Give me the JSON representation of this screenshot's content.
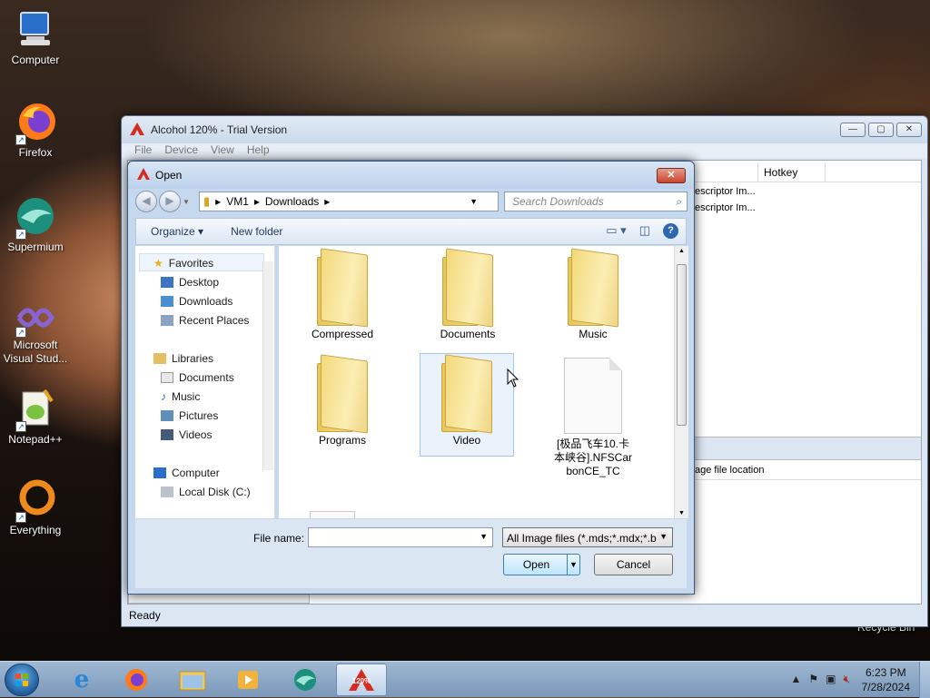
{
  "desktop": {
    "icons": [
      {
        "label": "Computer",
        "icon": "computer-icon"
      },
      {
        "label": "Firefox",
        "icon": "firefox-icon"
      },
      {
        "label": "Supermium",
        "icon": "supermium-icon"
      },
      {
        "label": "Microsoft Visual Stud...",
        "icon": "visual-studio-icon"
      },
      {
        "label": "Notepad++",
        "icon": "notepadpp-icon"
      },
      {
        "label": "Everything",
        "icon": "everything-icon"
      }
    ],
    "recycle_label": "Recycle Bin"
  },
  "main_window": {
    "title": "Alcohol 120% - Trial Version",
    "menu": [
      "File",
      "Device",
      "View",
      "Help"
    ],
    "list_header": {
      "col1": "Hotkey"
    },
    "list_rows": [
      "escriptor Im...",
      "escriptor Im..."
    ],
    "lower_header": "age file location",
    "status": "Ready",
    "buttons": {
      "min": "—",
      "max": "▢",
      "close": "✕"
    }
  },
  "dialog": {
    "title": "Open",
    "close": "✕",
    "breadcrumb": [
      "VM1",
      "Downloads"
    ],
    "search_placeholder": "Search Downloads",
    "organize": "Organize ▾",
    "new_folder": "New folder",
    "nav": {
      "favorites": "Favorites",
      "desktop": "Desktop",
      "downloads": "Downloads",
      "recent": "Recent Places",
      "libraries": "Libraries",
      "documents": "Documents",
      "music": "Music",
      "pictures": "Pictures",
      "videos": "Videos",
      "computer": "Computer",
      "local_disk": "Local Disk (C:)"
    },
    "files": [
      {
        "name": "Compressed",
        "type": "folder"
      },
      {
        "name": "Documents",
        "type": "folder"
      },
      {
        "name": "Music",
        "type": "folder"
      },
      {
        "name": "Programs",
        "type": "folder"
      },
      {
        "name": "Video",
        "type": "folder"
      },
      {
        "name": "[极品飞车10.卡本峡谷].NFSCarbonCE_TC",
        "type": "file"
      }
    ],
    "file_name_label": "File name:",
    "file_name_value": "",
    "filter": "All Image files (*.mds;*.mdx;*.b",
    "open": "Open",
    "cancel": "Cancel"
  },
  "taskbar": {
    "time": "6:23 PM",
    "date": "7/28/2024",
    "alcohol_badge": "120%"
  }
}
